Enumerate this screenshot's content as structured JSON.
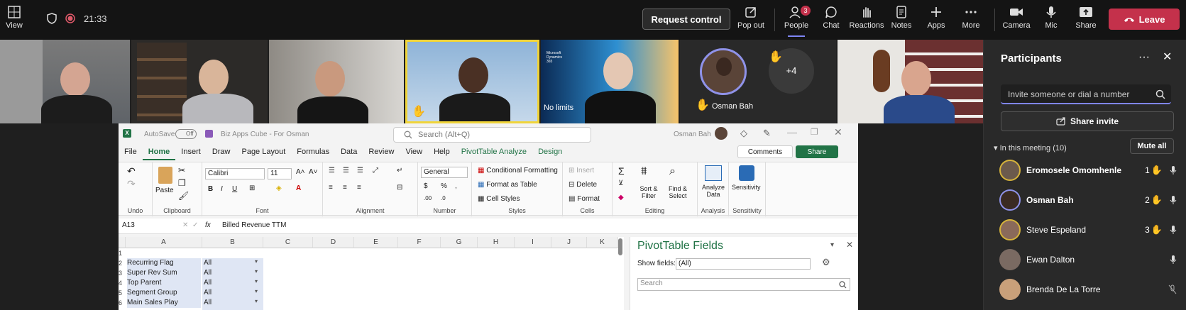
{
  "topbar": {
    "view_label": "View",
    "time": "21:33",
    "request_control": "Request control",
    "items": [
      {
        "label": "Pop out",
        "icon": "pop-out-icon"
      },
      {
        "label": "People",
        "icon": "people-icon",
        "badge": "3"
      },
      {
        "label": "Chat",
        "icon": "chat-icon"
      },
      {
        "label": "Reactions",
        "icon": "reactions-icon"
      },
      {
        "label": "Notes",
        "icon": "notes-icon"
      },
      {
        "label": "Apps",
        "icon": "apps-icon"
      },
      {
        "label": "More",
        "icon": "more-icon"
      },
      {
        "label": "Camera",
        "icon": "camera-icon"
      },
      {
        "label": "Mic",
        "icon": "mic-icon"
      },
      {
        "label": "Share",
        "icon": "share-icon"
      }
    ],
    "leave": "Leave",
    "leave_color": "#c4314b"
  },
  "video": {
    "label_nolimits": "No limits",
    "osman_label": "Osman Bah",
    "overflow": "+4",
    "tile_logo": "Microsoft Dynamics 365"
  },
  "panel": {
    "title": "Participants",
    "invite_placeholder": "Invite someone or dial a number",
    "share_invite": "Share invite",
    "in_meeting": "In this meeting (10)",
    "mute_all": "Mute all",
    "participants": [
      {
        "name": "Eromosele Omomhenle",
        "hand": "1"
      },
      {
        "name": "Osman Bah",
        "hand": "2"
      },
      {
        "name": "Steve Espeland",
        "hand": "3"
      },
      {
        "name": "Ewan Dalton",
        "hand": ""
      },
      {
        "name": "Brenda De La Torre",
        "hand": ""
      }
    ]
  },
  "excel": {
    "autosave": "AutoSave",
    "autosave_state": "Off",
    "filename": "Biz Apps Cube - For Osman",
    "search": "Search (Alt+Q)",
    "user": "Osman Bah",
    "menu": [
      "File",
      "Home",
      "Insert",
      "Draw",
      "Page Layout",
      "Formulas",
      "Data",
      "Review",
      "View",
      "Help",
      "PivotTable Analyze",
      "Design"
    ],
    "comments": "Comments",
    "share": "Share",
    "ribbon": {
      "undo": "Undo",
      "paste": "Paste",
      "clipboard": "Clipboard",
      "font_name": "Calibri",
      "font_size": "11",
      "font": "Font",
      "alignment": "Alignment",
      "number_format": "General",
      "number": "Number",
      "cond_format": "Conditional Formatting",
      "format_table": "Format as Table",
      "cell_styles": "Cell Styles",
      "styles": "Styles",
      "insert": "Insert",
      "delete": "Delete",
      "format": "Format",
      "cells": "Cells",
      "sort_filter": "Sort & Filter",
      "find_select": "Find & Select",
      "editing": "Editing",
      "analyze_data": "Analyze Data",
      "analysis": "Analysis",
      "sensitivity": "Sensitivity"
    },
    "namebox": "A13",
    "fx": "fx",
    "formula": "Billed Revenue TTM",
    "columns": [
      "A",
      "B",
      "C",
      "D",
      "E",
      "F",
      "G",
      "H",
      "I",
      "J",
      "K"
    ],
    "rows": [
      {
        "n": "1",
        "a": "",
        "b": ""
      },
      {
        "n": "2",
        "a": "Recurring Flag",
        "b": "All"
      },
      {
        "n": "3",
        "a": "Super Rev Sum Division",
        "b": "All"
      },
      {
        "n": "4",
        "a": "Top Parent",
        "b": "All"
      },
      {
        "n": "5",
        "a": "Segment Group",
        "b": "All"
      },
      {
        "n": "6",
        "a": "Main Sales Play",
        "b": "All"
      }
    ],
    "pivot": {
      "title": "PivotTable Fields",
      "show_fields": "Show fields:",
      "show_value": "(All)",
      "search": "Search"
    }
  }
}
